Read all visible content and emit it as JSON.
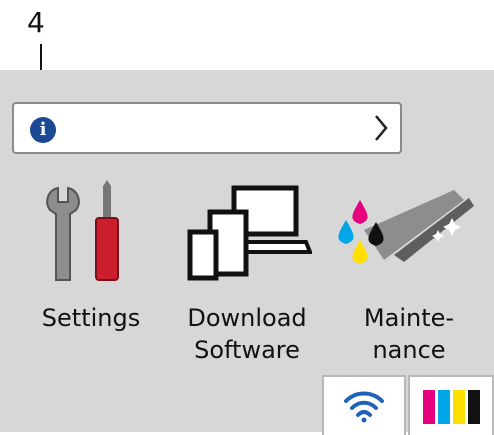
{
  "callout": {
    "number": "4"
  },
  "tiles": [
    {
      "label_line1": "Settings",
      "label_line2": ""
    },
    {
      "label_line1": "Download",
      "label_line2": "Software"
    },
    {
      "label_line1": "Mainte-",
      "label_line2": "nance"
    }
  ],
  "colors": {
    "screen_bg": "#d7d7d7",
    "info_blue": "#1b4a95",
    "tool_red": "#cc1f2d",
    "wifi_blue": "#1e63b8",
    "ink_cyan": "#00a6e6",
    "ink_magenta": "#e6007e",
    "ink_yellow": "#ffe000",
    "ink_black": "#111111"
  },
  "icons": [
    "info-icon",
    "chevron-right-icon",
    "settings-tools-icon",
    "download-software-devices-icon",
    "maintenance-ink-icon",
    "wifi-icon",
    "ink-level-icon"
  ]
}
